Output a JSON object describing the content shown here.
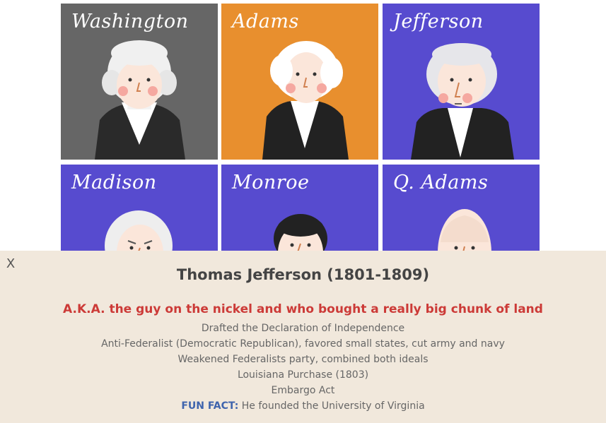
{
  "cards": [
    {
      "name": "Washington",
      "bg": "#666666",
      "hair": "#f0f0f0",
      "coat": "#2a2a2a"
    },
    {
      "name": "Adams",
      "bg": "#e88f2e",
      "hair": "#ffffff",
      "coat": "#222222"
    },
    {
      "name": "Jefferson",
      "bg": "#574bcf",
      "hair": "#e6e6ea",
      "coat": "#222222"
    },
    {
      "name": "Madison",
      "bg": "#574bcf",
      "hair": "#eeeeee",
      "coat": "#222222"
    },
    {
      "name": "Monroe",
      "bg": "#574bcf",
      "hair": "#222222",
      "coat": "#222222"
    },
    {
      "name": "Q. Adams",
      "bg": "#574bcf",
      "hair": "#f4dccd",
      "coat": "#222222"
    }
  ],
  "panel": {
    "close_label": "X",
    "title": "Thomas Jefferson (1801-1809)",
    "aka": "A.K.A. the guy on the nickel and who bought a really big chunk of land",
    "facts": [
      "Drafted the Declaration of Independence",
      "Anti-Federalist (Democratic Republican), favored small states, cut army and navy",
      "Weakened Federalists party, combined both ideals",
      "Louisiana Purchase (1803)",
      "Embargo Act"
    ],
    "fun_fact_label": "FUN FACT:",
    "fun_fact_text": " He founded the University of Virginia"
  },
  "colors": {
    "panel_bg": "#f1e8dc",
    "aka": "#cc3a37",
    "fun_label": "#3f64ad"
  }
}
